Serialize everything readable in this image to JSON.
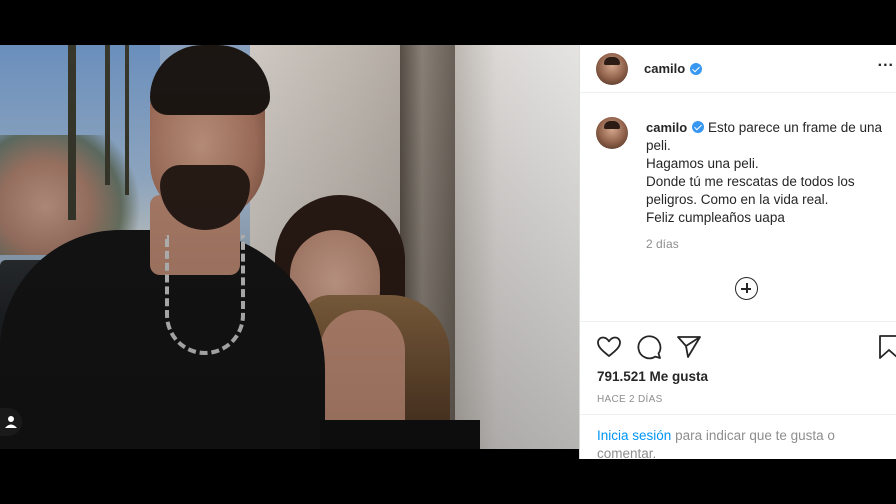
{
  "post": {
    "username": "camilo",
    "more_label": "...",
    "caption_lines": [
      "Esto parece un frame de una",
      "peli.",
      "Hagamos una peli.",
      "Donde tú me rescatas de todos los",
      "peligros. Como en la vida real.",
      "Feliz cumpleaños uapa"
    ],
    "caption_time": "2 días",
    "likes": "791.521 Me gusta",
    "posted_ago": "HACE 2 DÍAS",
    "login_link": "Inicia sesión",
    "login_text": "para indicar que te gusta o comentar."
  },
  "colors": {
    "link": "#0095f6",
    "verified": "#3897f0",
    "muted": "#8e8e8e",
    "text": "#262626"
  },
  "icons": [
    "heart-icon",
    "comment-icon",
    "share-icon",
    "bookmark-icon",
    "add-comment-icon",
    "verified-icon",
    "more-options-icon",
    "user-tag-icon"
  ]
}
